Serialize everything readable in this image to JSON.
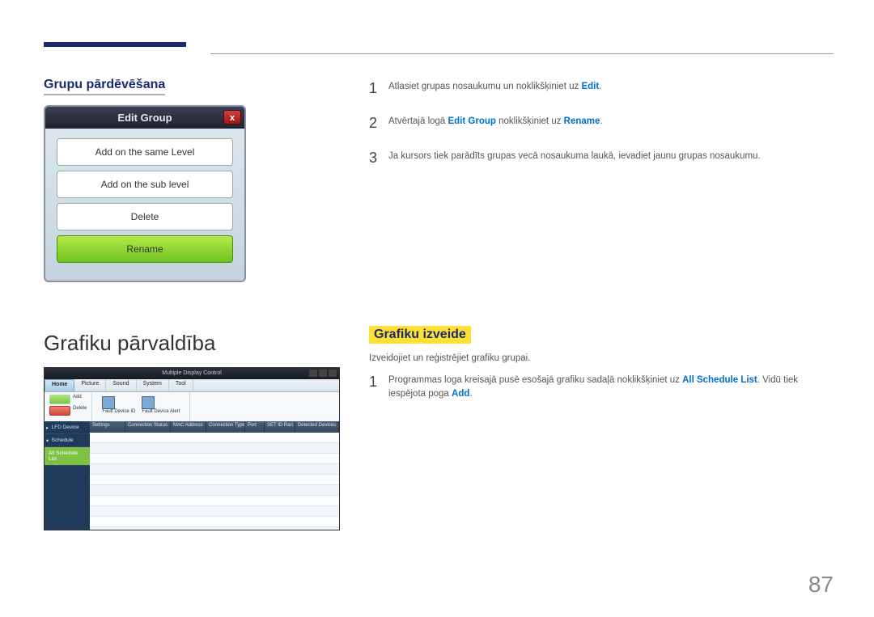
{
  "page_number": "87",
  "section1": {
    "heading": "Grupu pārdēvēšana",
    "dialog": {
      "title": "Edit Group",
      "close_symbol": "x",
      "btn_same": "Add on the same Level",
      "btn_sub": "Add on the sub level",
      "btn_delete": "Delete",
      "btn_rename": "Rename"
    },
    "steps": {
      "s1_num": "1",
      "s1_pre": "Atlasiet grupas nosaukumu un noklikšķiniet uz ",
      "s1_kw": "Edit",
      "s1_post": ".",
      "s2_num": "2",
      "s2_pre": "Atvērtajā logā ",
      "s2_kw1": "Edit Group",
      "s2_mid": " noklikšķiniet uz ",
      "s2_kw2": "Rename",
      "s2_post": ".",
      "s3_num": "3",
      "s3_text": "Ja kursors tiek parādīts grupas vecā nosaukuma laukā, ievadiet jaunu grupas nosaukumu."
    }
  },
  "section2": {
    "heading_left": "Grafiku pārvaldība",
    "heading_right": "Grafiku izveide",
    "intro": "Izveidojiet un reģistrējiet grafiku grupai.",
    "steps": {
      "s1_num": "1",
      "s1_pre": "Programmas loga kreisajā pusē esošajā grafiku sadaļā noklikšķiniet uz ",
      "s1_kw1": "All Schedule List",
      "s1_mid": ". Vidū tiek iespējota poga ",
      "s1_kw2": "Add",
      "s1_post": "."
    },
    "app": {
      "title": "Multiple Display Control",
      "tabs": {
        "home": "Home",
        "picture": "Picture",
        "sound": "Sound",
        "system": "System",
        "tool": "Tool"
      },
      "ribbon": {
        "add": "Add",
        "delete": "Delete",
        "fault_id": "Fault Device ID",
        "fault_alert": "Fault Device Alert"
      },
      "sidebar": {
        "lfd": "LFD Device",
        "schedule": "Schedule",
        "all_list": "All Schedule List"
      },
      "table_headers": [
        "Settings",
        "Connection Status",
        "MAC Address",
        "Connection Type",
        "Port",
        "SET ID Ran...",
        "Detected Devices"
      ]
    }
  }
}
